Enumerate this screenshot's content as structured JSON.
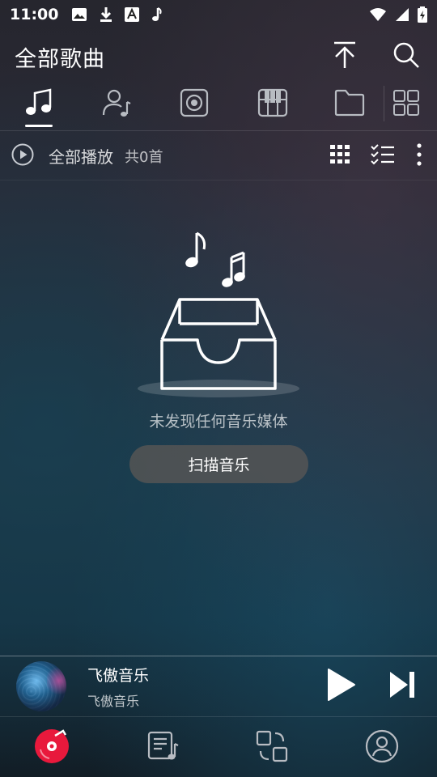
{
  "status_bar": {
    "time": "11:00",
    "icons_left": [
      "image-icon",
      "download-icon",
      "font-icon",
      "music-note-icon"
    ],
    "icons_right": [
      "wifi-icon",
      "signal-icon",
      "battery-charging-icon"
    ]
  },
  "header": {
    "title": "全部歌曲",
    "actions": [
      "scroll-to-top-icon",
      "search-icon"
    ]
  },
  "tabs": [
    {
      "name": "songs",
      "icon": "music-note-icon",
      "active": true
    },
    {
      "name": "artists",
      "icon": "artist-icon",
      "active": false
    },
    {
      "name": "albums",
      "icon": "album-icon",
      "active": false
    },
    {
      "name": "genres",
      "icon": "piano-icon",
      "active": false
    },
    {
      "name": "folders",
      "icon": "folder-icon",
      "active": false
    },
    {
      "name": "more",
      "icon": "grid-icon",
      "active": false
    }
  ],
  "toolbar": {
    "play_all_label": "全部播放",
    "song_count": "共0首",
    "actions": [
      "grid-view-icon",
      "multi-select-icon",
      "more-vertical-icon"
    ]
  },
  "empty_state": {
    "message": "未发现任何音乐媒体",
    "scan_button_label": "扫描音乐"
  },
  "mini_player": {
    "title": "飞傲音乐",
    "artist": "飞傲音乐",
    "controls": [
      "play-icon",
      "next-icon"
    ]
  },
  "bottom_nav": [
    {
      "name": "library",
      "icon": "vinyl-icon",
      "active": true
    },
    {
      "name": "playlists",
      "icon": "playlist-icon",
      "active": false
    },
    {
      "name": "transfer",
      "icon": "transfer-icon",
      "active": false
    },
    {
      "name": "profile",
      "icon": "profile-icon",
      "active": false
    }
  ],
  "colors": {
    "accent": "#e8193c",
    "text_primary": "#ffffff",
    "scan_button_bg": "#555555"
  }
}
